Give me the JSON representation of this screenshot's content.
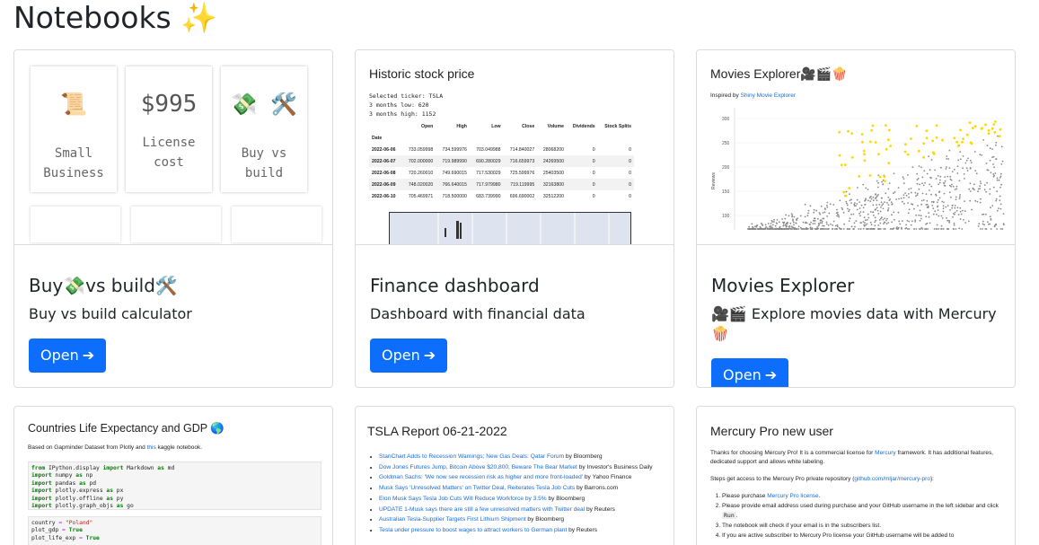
{
  "page": {
    "title": "Notebooks ✨"
  },
  "cards": [
    {
      "title": "Buy💸vs build🛠️",
      "description": "Buy vs build calculator",
      "button": "Open",
      "thumbnail": {
        "tiles": [
          {
            "icon": "📜",
            "label_line1": "Small",
            "label_line2": "Business"
          },
          {
            "value": "$995",
            "label_line1": "License",
            "label_line2": "cost"
          },
          {
            "icon": "💸 🛠️",
            "label_line1": "Buy vs",
            "label_line2": "build"
          }
        ]
      }
    },
    {
      "title": "Finance dashboard",
      "description": "Dashboard with financial data",
      "button": "Open",
      "thumbnail": {
        "heading": "Historic stock price",
        "lines": [
          "Selected ticker: TSLA",
          "3 months low: 620",
          "3 months high: 1152"
        ],
        "table": {
          "columns": [
            "",
            "Open",
            "High",
            "Low",
            "Close",
            "Volume",
            "Dividends",
            "Stock Splits"
          ],
          "index_label": "Date",
          "rows": [
            [
              "2022-06-06",
              "733.059998",
              "734.599976",
              "703.049988",
              "714.840027",
              "28068200",
              "0",
              "0"
            ],
            [
              "2022-06-07",
              "702.000000",
              "719.989990",
              "690.280029",
              "716.659973",
              "24269500",
              "0",
              "0"
            ],
            [
              "2022-06-08",
              "720.260010",
              "749.690015",
              "717.530029",
              "725.599976",
              "25403500",
              "0",
              "0"
            ],
            [
              "2022-06-09",
              "748.020020",
              "766.640015",
              "717.979980",
              "719.119995",
              "32163800",
              "0",
              "0"
            ],
            [
              "2022-06-10",
              "705.469971",
              "718.500000",
              "683.739990",
              "696.690002",
              "32512200",
              "0",
              "0"
            ]
          ]
        }
      }
    },
    {
      "title": "Movies Explorer",
      "description": "🎥🎬 Explore movies data with Mercury🍿",
      "button": "Open",
      "thumbnail": {
        "heading": "Movies Explorer🎥🎬🍿",
        "inspired_prefix": "Inspired by ",
        "inspired_link": "Shiny Movie Explorer",
        "ylabel": "Reviews",
        "yticks": [
          "300",
          "250",
          "200",
          "150",
          "100"
        ]
      }
    },
    {
      "thumbnail": {
        "heading": "Countries Life Expectancy and GDP 🌎",
        "intro_prefix": "Based on Gapminder Dataset from Plotly and ",
        "intro_link": "this",
        "intro_suffix": " kaggle notebook.",
        "imports": [
          {
            "kw1": "from",
            "mod": " IPython.display ",
            "kw2": "import",
            "rest": " Markdown ",
            "kw3": "as",
            "alias": " md"
          },
          {
            "kw1": "import",
            "mod": " numpy ",
            "kw2": "as",
            "rest": " np",
            "kw3": "",
            "alias": ""
          },
          {
            "kw1": "import",
            "mod": " pandas ",
            "kw2": "as",
            "rest": " pd",
            "kw3": "",
            "alias": ""
          },
          {
            "kw1": "import",
            "mod": " plotly.express ",
            "kw2": "as",
            "rest": " px",
            "kw3": "",
            "alias": ""
          },
          {
            "kw1": "import",
            "mod": " plotly.offline ",
            "kw2": "as",
            "rest": " py",
            "kw3": "",
            "alias": ""
          },
          {
            "kw1": "import",
            "mod": " plotly.graph_objs ",
            "kw2": "as",
            "rest": " go",
            "kw3": "",
            "alias": ""
          }
        ],
        "params": [
          {
            "name": "country",
            "op": " = ",
            "val": "\"Poland\"",
            "is_str": true
          },
          {
            "name": "plot_gdp",
            "op": " = ",
            "val": "True",
            "is_str": false
          },
          {
            "name": "plot_life_exp",
            "op": " = ",
            "val": "True",
            "is_str": false
          }
        ]
      }
    },
    {
      "thumbnail": {
        "heading": "TSLA Report 06-21-2022",
        "news": [
          {
            "link": "StanChart Adds to Recession Warnings; New Gas Deals: Qatar Forum",
            "source": " by Bloomberg"
          },
          {
            "link": "Dow Jones Futures Jump, Bitcoin Above $20,800; Beware The Bear Market",
            "source": " by Investor's Business Daily"
          },
          {
            "link": "Goldman Sachs: 'We now see recession risk as higher and more front-loaded'",
            "source": " by Yahoo Finance"
          },
          {
            "link": "Musk Says 'Unresolved Matters' on Twitter Deal, Reiterates Tesla Job Cuts",
            "source": " by Barrons.com"
          },
          {
            "link": "Elon Musk Says Tesla Job Cuts Will Reduce Workforce by 3.5%",
            "source": " by Bloomberg"
          },
          {
            "link": "UPDATE 1-Musk says there are still a few unresolved matters with Twitter deal",
            "source": " by Reuters"
          },
          {
            "link": "Australian Tesla-Supplier Targets First Lithium Shipment",
            "source": " by Bloomberg"
          },
          {
            "link": "Tesla under pressure to boost wages to attract workers to German plant",
            "source": " by Reuters"
          }
        ]
      }
    },
    {
      "thumbnail": {
        "heading": "Mercury Pro new user",
        "p1_prefix": "Thanks for choosing Mercury Pro! It is a commercial license for ",
        "p1_link": "Mercury",
        "p1_suffix": " framework. It has additional features, dedicated support and allows white labeling.",
        "p2_prefix": "Steps get access to the Mercury Pro private repository (",
        "p2_link": "github.com/mljar/mercury-pro",
        "p2_suffix": "):",
        "steps": [
          {
            "prefix": "Please purchase ",
            "link": "Mercury Pro license",
            "suffix": "."
          },
          {
            "prefix": "Please provide email address used during purchase and your GitHub username in the left sidebar and click ",
            "code": "Run",
            "suffix": "."
          },
          {
            "prefix": "The notebook will check if your email is in the subscribers list.",
            "link": "",
            "suffix": ""
          },
          {
            "prefix": "If you are active subscriber to Mercury Pro license your GitHub username will be added to",
            "link": "",
            "suffix": ""
          }
        ]
      }
    }
  ],
  "colors": {
    "primary": "#0d6efd",
    "link": "#1a6bd4",
    "scatter_gray": "#888888",
    "scatter_highlight": "#ffd700"
  }
}
